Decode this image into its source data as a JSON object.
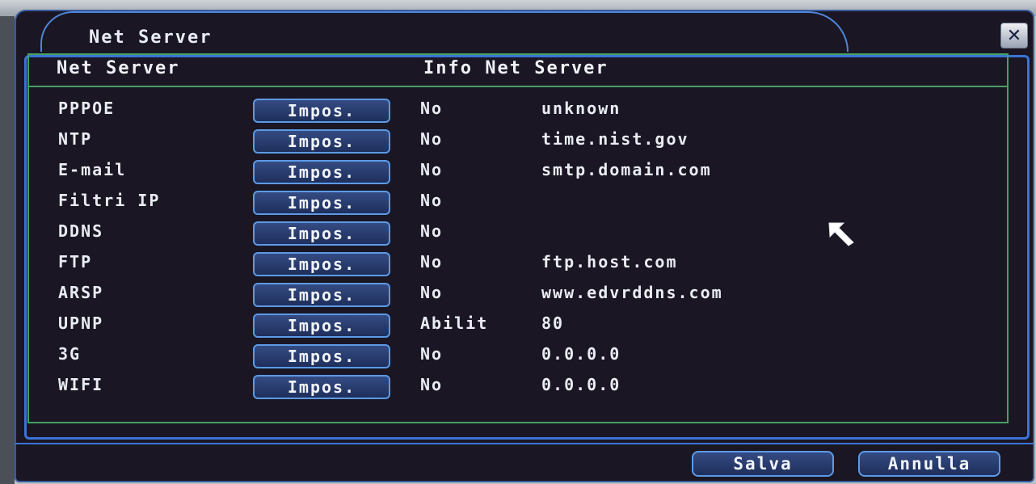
{
  "window": {
    "title": "Net Server",
    "close_icon": "close-icon"
  },
  "table": {
    "headers": {
      "col1": "Net Server",
      "col2": "Info Net Server"
    },
    "rows": [
      {
        "name": "PPPOE",
        "button": "Impos.",
        "status": "No",
        "info": "unknown"
      },
      {
        "name": "NTP",
        "button": "Impos.",
        "status": "No",
        "info": "time.nist.gov"
      },
      {
        "name": "E-mail",
        "button": "Impos.",
        "status": "No",
        "info": "smtp.domain.com"
      },
      {
        "name": "Filtri IP",
        "button": "Impos.",
        "status": "No",
        "info": ""
      },
      {
        "name": "DDNS",
        "button": "Impos.",
        "status": "No",
        "info": ""
      },
      {
        "name": "FTP",
        "button": "Impos.",
        "status": "No",
        "info": "ftp.host.com"
      },
      {
        "name": "ARSP",
        "button": "Impos.",
        "status": "No",
        "info": "www.edvrddns.com"
      },
      {
        "name": "UPNP",
        "button": "Impos.",
        "status": "Abilit",
        "info": "80"
      },
      {
        "name": "3G",
        "button": "Impos.",
        "status": "No",
        "info": "0.0.0.0"
      },
      {
        "name": "WIFI",
        "button": "Impos.",
        "status": "No",
        "info": "0.0.0.0"
      }
    ]
  },
  "footer": {
    "save_label": "Salva",
    "cancel_label": "Annulla"
  },
  "colors": {
    "background": "#1a1623",
    "accent": "#3a74d6",
    "grid": "#46a060",
    "text": "#e9edf3"
  }
}
